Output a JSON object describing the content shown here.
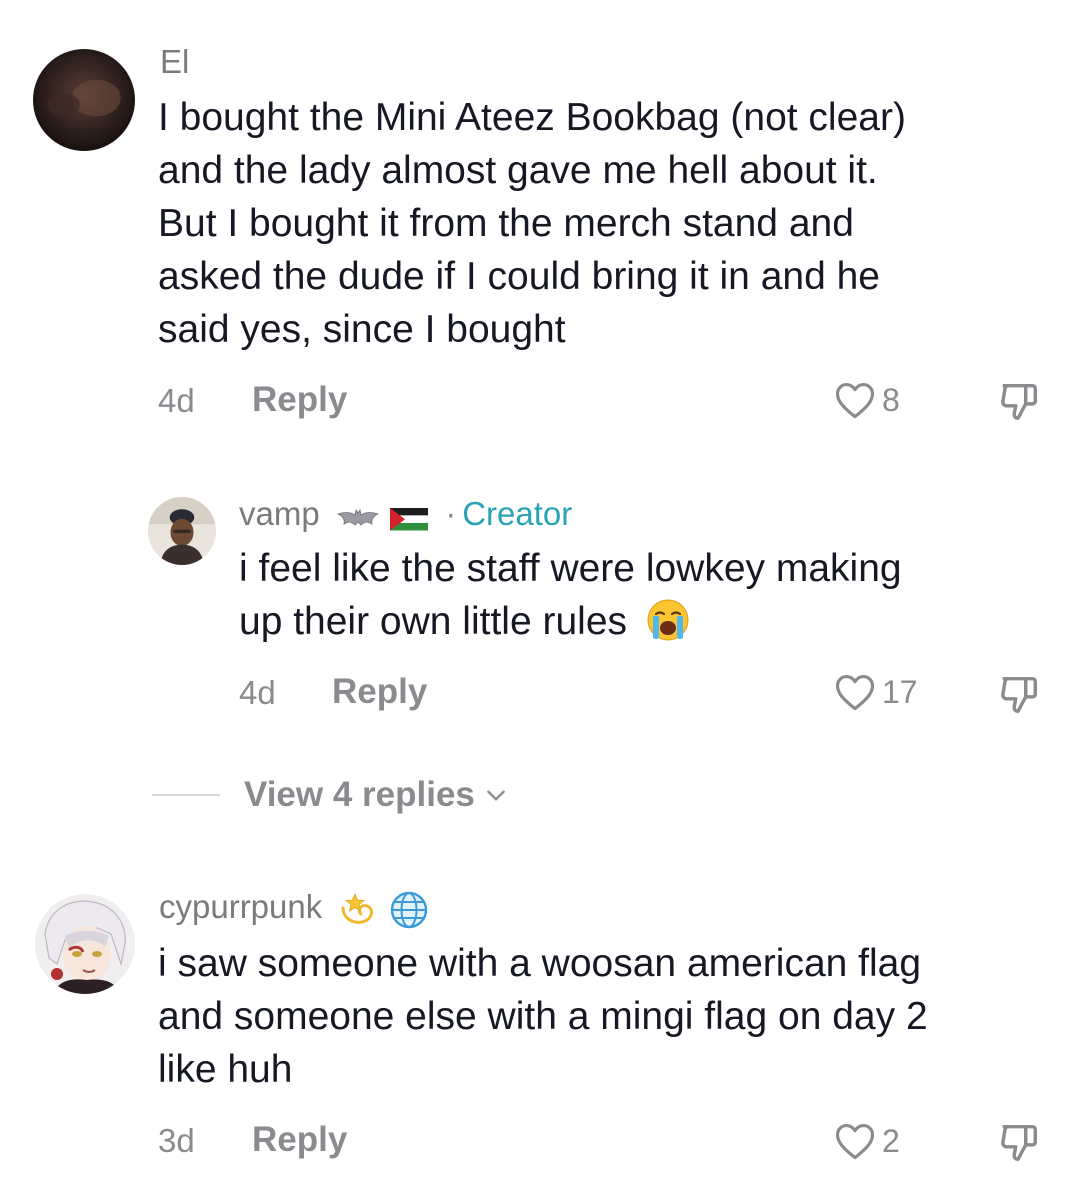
{
  "comments": [
    {
      "username": "El",
      "lines": [
        "I bought the Mini Ateez Bookbag (not clear)",
        "and the lady almost gave me hell about it.",
        "But I bought it from the merch stand and",
        "asked the dude if I could bring it in and he",
        "said yes, since I bought"
      ],
      "time": "4d",
      "reply_label": "Reply",
      "likes": "8",
      "icons": [
        "heart-icon",
        "thumbs-down-icon"
      ]
    },
    {
      "username": "vamp",
      "username_badges": [
        "bat-emoji",
        "palestine-flag-emoji"
      ],
      "separator": "·",
      "creator_label": "Creator",
      "lines": [
        "i feel like the staff were lowkey making",
        "up their own little rules"
      ],
      "trailing_emoji": "loudly-crying-face-emoji",
      "time": "4d",
      "reply_label": "Reply",
      "likes": "17",
      "view_replies_label": "View 4 replies"
    },
    {
      "username": "cypurrpunk",
      "username_badges": [
        "dizzy-emoji",
        "globe-emoji"
      ],
      "lines": [
        "i saw someone with a woosan american flag",
        "and someone else with a mingi flag on day 2",
        "like huh"
      ],
      "time": "3d",
      "reply_label": "Reply",
      "likes": "2"
    }
  ],
  "colors": {
    "text": "#161823",
    "muted": "#8a8a8f",
    "creator": "#2aa3b5"
  }
}
